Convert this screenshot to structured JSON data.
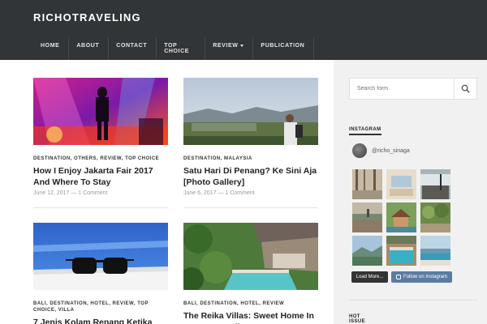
{
  "site": {
    "title": "RICHOTRAVELING"
  },
  "nav": {
    "items": [
      {
        "label": "HOME"
      },
      {
        "label": "ABOUT"
      },
      {
        "label": "CONTACT"
      },
      {
        "label": "TOP CHOICE"
      },
      {
        "label": "REVIEW"
      },
      {
        "label": "PUBLICATION"
      }
    ]
  },
  "posts": [
    {
      "categories": "DESTINATION, OTHERS, REVIEW, TOP CHOICE",
      "title": "How I Enjoy Jakarta Fair 2017 And Where To Stay",
      "meta": "June 12, 2017 — 1 Comment"
    },
    {
      "categories": "DESTINATION, MALAYSIA",
      "title": "Satu Hari Di Penang? Ke Sini Aja [Photo Gallery]",
      "meta": "June 6, 2017 — 1 Comment"
    },
    {
      "categories": "BALI, DESTINATION, HOTEL, REVIEW, TOP CHOICE, VILLA",
      "title": "7 Jenis Kolam Renang Ketika",
      "meta": ""
    },
    {
      "categories": "BALI, DESTINATION, HOTEL, REVIEW",
      "title": "The Reika Villas: Sweet Home In Ungasan, Bali",
      "meta": ""
    }
  ],
  "sidebar": {
    "search": {
      "placeholder": "Search form"
    },
    "instagram": {
      "title": "INSTAGRAM",
      "username": "@richo_sinaga",
      "load_more": "Load More...",
      "follow": "Follow on Instagram"
    },
    "hot_issue": {
      "title": "HOT ISSUE"
    }
  },
  "colors": {
    "header_bg": "#323538",
    "sidebar_bg": "#f1f1f1",
    "follow_btn": "#5a7ca0"
  }
}
